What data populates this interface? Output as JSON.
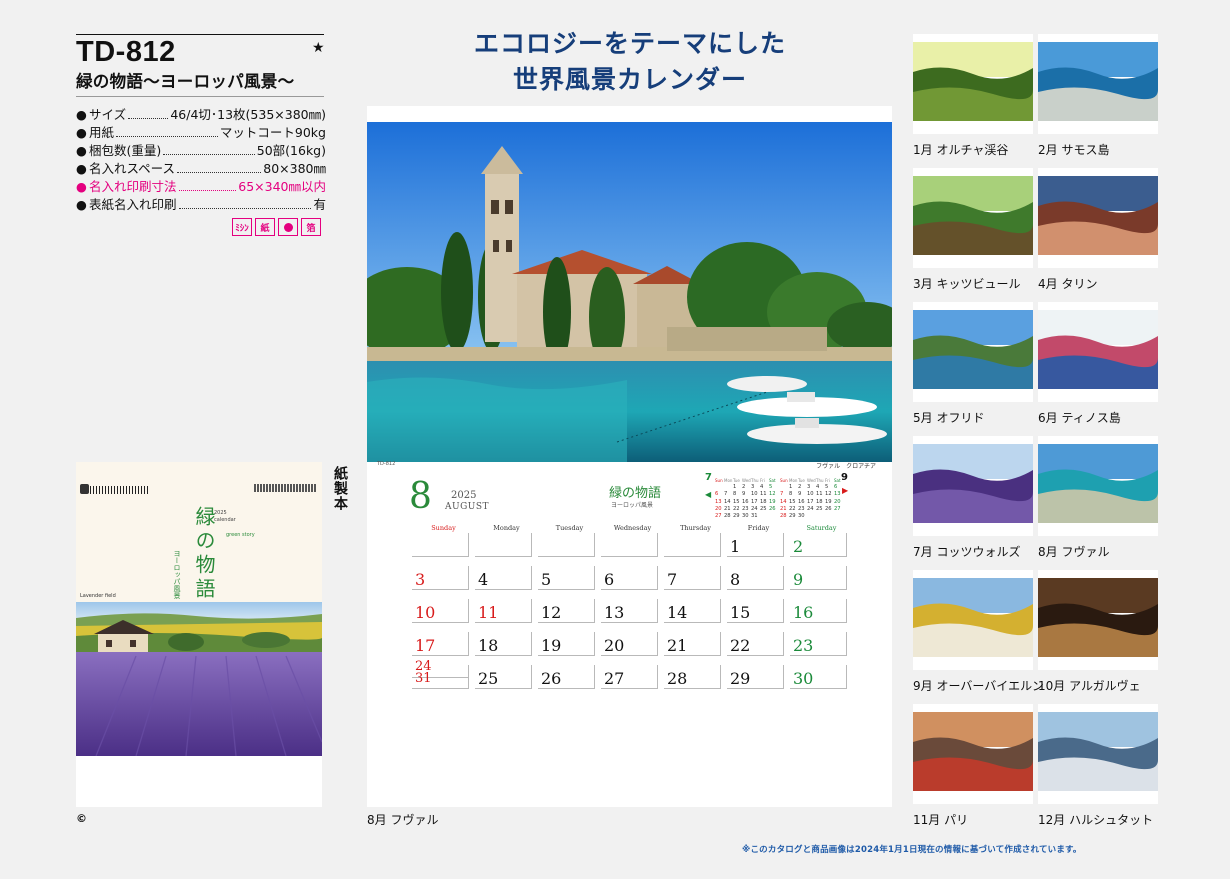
{
  "product": {
    "code": "TD-812",
    "star": "★",
    "name": "緑の物語〜ヨーロッパ風景〜"
  },
  "specs": [
    {
      "label": "サイズ",
      "dots": "…",
      "value": "46/4切･13枚(535×380㎜)",
      "highlight": false
    },
    {
      "label": "用紙",
      "dots": "",
      "value": "マットコート90kg",
      "highlight": false
    },
    {
      "label": "梱包数(重量)",
      "dots": "",
      "value": "50部(16kg)",
      "highlight": false
    },
    {
      "label": "名入れスペース",
      "dots": "",
      "value": "80×380㎜",
      "highlight": false
    },
    {
      "label": "名入れ印刷寸法",
      "dots": "",
      "value": "65×340㎜以内",
      "highlight": true
    },
    {
      "label": "表紙名入れ印刷",
      "dots": "",
      "value": "有",
      "highlight": false
    }
  ],
  "badges": [
    "ﾐｼﾝ",
    "紙",
    "",
    "箔"
  ],
  "cover": {
    "title": "緑の物語",
    "subtitle": "ヨーロッパ風景",
    "year_text": "2025",
    "calendar_text": "calendar",
    "green_text": "green story",
    "caption_left": "Lavender field",
    "caption_right": "",
    "binding": "紙製本"
  },
  "copyright": "©",
  "headline": [
    "エコロジーをテーマにした",
    "世界風景カレンダー"
  ],
  "main_calendar": {
    "photo_note": "",
    "photo_caption_left": "TD-812",
    "photo_caption_right": "フヴァル　クロアチア",
    "month_num": "8",
    "year": "2025",
    "month_en": "AUGUST",
    "brand_title": "緑の物語",
    "brand_sub": "ヨーロッパ風景",
    "prev_month": "7",
    "next_month": "9",
    "weekdays": [
      "Sunday",
      "Monday",
      "Tuesday",
      "Wednesday",
      "Thursday",
      "Friday",
      "Saturday"
    ],
    "weeks": [
      [
        "",
        "",
        "",
        "",
        "",
        "1",
        "2"
      ],
      [
        "3",
        "4",
        "5",
        "6",
        "7",
        "8",
        "9"
      ],
      [
        "10",
        "11",
        "12",
        "13",
        "14",
        "15",
        "16"
      ],
      [
        "17",
        "18",
        "19",
        "20",
        "21",
        "22",
        "23"
      ],
      [
        "24/31",
        "25",
        "26",
        "27",
        "28",
        "29",
        "30"
      ]
    ],
    "holidays": [
      "11"
    ],
    "caption": "8月 フヴァル"
  },
  "thumbnails": [
    {
      "label": "1月 オルチャ渓谷"
    },
    {
      "label": "2月 サモス島"
    },
    {
      "label": "3月 キッツビュール"
    },
    {
      "label": "4月 タリン"
    },
    {
      "label": "5月 オフリド"
    },
    {
      "label": "6月 ティノス島"
    },
    {
      "label": "7月 コッツウォルズ"
    },
    {
      "label": "8月 フヴァル"
    },
    {
      "label": "9月 オーバーバイエルン"
    },
    {
      "label": "10月 アルガルヴェ"
    },
    {
      "label": "11月 パリ"
    },
    {
      "label": "12月 ハルシュタット"
    }
  ],
  "disclaimer": "※このカタログと商品画像は2024年1月1日現在の情報に基づいて作成されています。",
  "colors": {
    "accent_pink": "#e4007f",
    "headline_blue": "#163e7a",
    "sunday_red": "#d81b1b",
    "saturday_green": "#1b8a3a",
    "brand_green": "#2a8a3a"
  }
}
